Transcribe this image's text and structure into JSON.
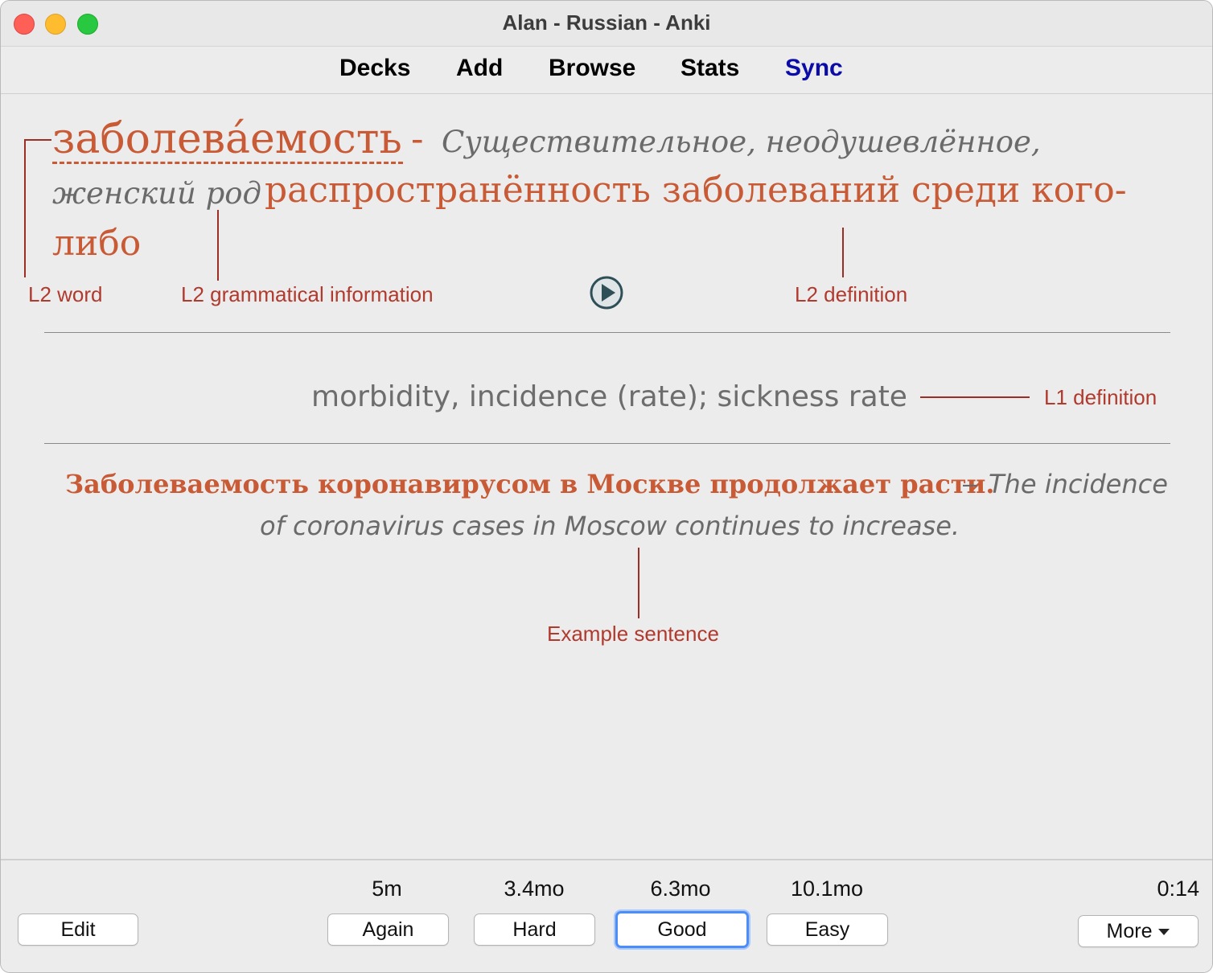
{
  "window": {
    "title": "Alan - Russian - Anki"
  },
  "toolbar": {
    "decks": "Decks",
    "add": "Add",
    "browse": "Browse",
    "stats": "Stats",
    "sync": "Sync"
  },
  "card": {
    "word": "заболева́емость",
    "dash": "-",
    "grammar_line1": "Существительное, неодушевлённое,",
    "grammar_line2": "женский род",
    "definition_line1": "распространённость заболеваний среди кого-",
    "definition_line2": "либо",
    "l1_definition": "morbidity, incidence (rate); sickness rate",
    "example_ru": "Заболеваемость коронавирусом в Москве продолжает расти.",
    "example_dash": "–",
    "example_en_line1": "The incidence",
    "example_en_line2": "of coronavirus cases in Moscow continues to increase."
  },
  "annotations": {
    "l2_word": "L2 word",
    "l2_grammar": "L2 grammatical information",
    "l2_definition": "L2 definition",
    "l1_definition": "L1 definition",
    "example_sentence": "Example sentence",
    "color": "#b03a2e"
  },
  "bottom": {
    "edit": "Edit",
    "again": {
      "label": "Again",
      "interval": "5m"
    },
    "hard": {
      "label": "Hard",
      "interval": "3.4mo"
    },
    "good": {
      "label": "Good",
      "interval": "6.3mo"
    },
    "easy": {
      "label": "Easy",
      "interval": "10.1mo"
    },
    "more": "More",
    "timer": "0:14"
  },
  "colors": {
    "accent_text": "#c85a35",
    "sync_link": "#0b0ba8",
    "focus_ring": "#4d8ef6"
  }
}
